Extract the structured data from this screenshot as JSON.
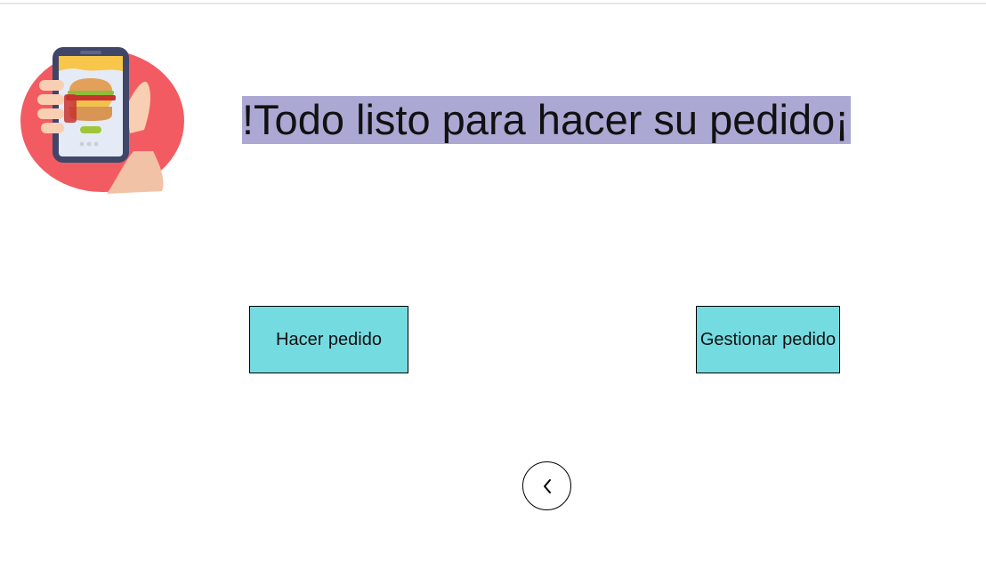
{
  "headline": {
    "text": "!Todo listo para hacer su pedido¡",
    "highlight_color": "#aba8d4"
  },
  "logo": {
    "icon": "phone-burger-order-icon",
    "colors": {
      "circle": "#f35b62",
      "phone": "#3f4668",
      "hand": "#f9cfb3"
    }
  },
  "actions": {
    "hacer_pedido_label": "Hacer pedido",
    "gestionar_pedido_label": "Gestionar pedido",
    "button_color": "#74dbe1"
  },
  "navigation": {
    "back_icon": "chevron-left-icon"
  }
}
